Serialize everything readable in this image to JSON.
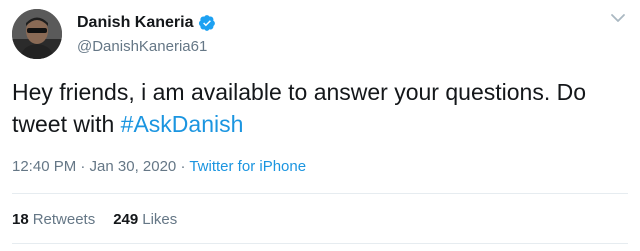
{
  "author": {
    "display_name": "Danish Kaneria",
    "handle": "@DanishKaneria61",
    "verified": true
  },
  "tweet": {
    "text_before_hashtag": "Hey friends, i am available to answer your questions. Do tweet with ",
    "hashtag": "#AskDanish"
  },
  "meta": {
    "timestamp": "12:40 PM · Jan 30, 2020",
    "separator": " · ",
    "source": "Twitter for iPhone"
  },
  "stats": {
    "retweets_count": "18",
    "retweets_label": "Retweets",
    "likes_count": "249",
    "likes_label": "Likes"
  },
  "colors": {
    "link": "#1b95e0",
    "verified": "#1da1f2",
    "muted": "#657786",
    "text": "#14171a"
  },
  "icons": {
    "verified": "verified-badge-icon",
    "caret": "chevron-down-icon"
  }
}
